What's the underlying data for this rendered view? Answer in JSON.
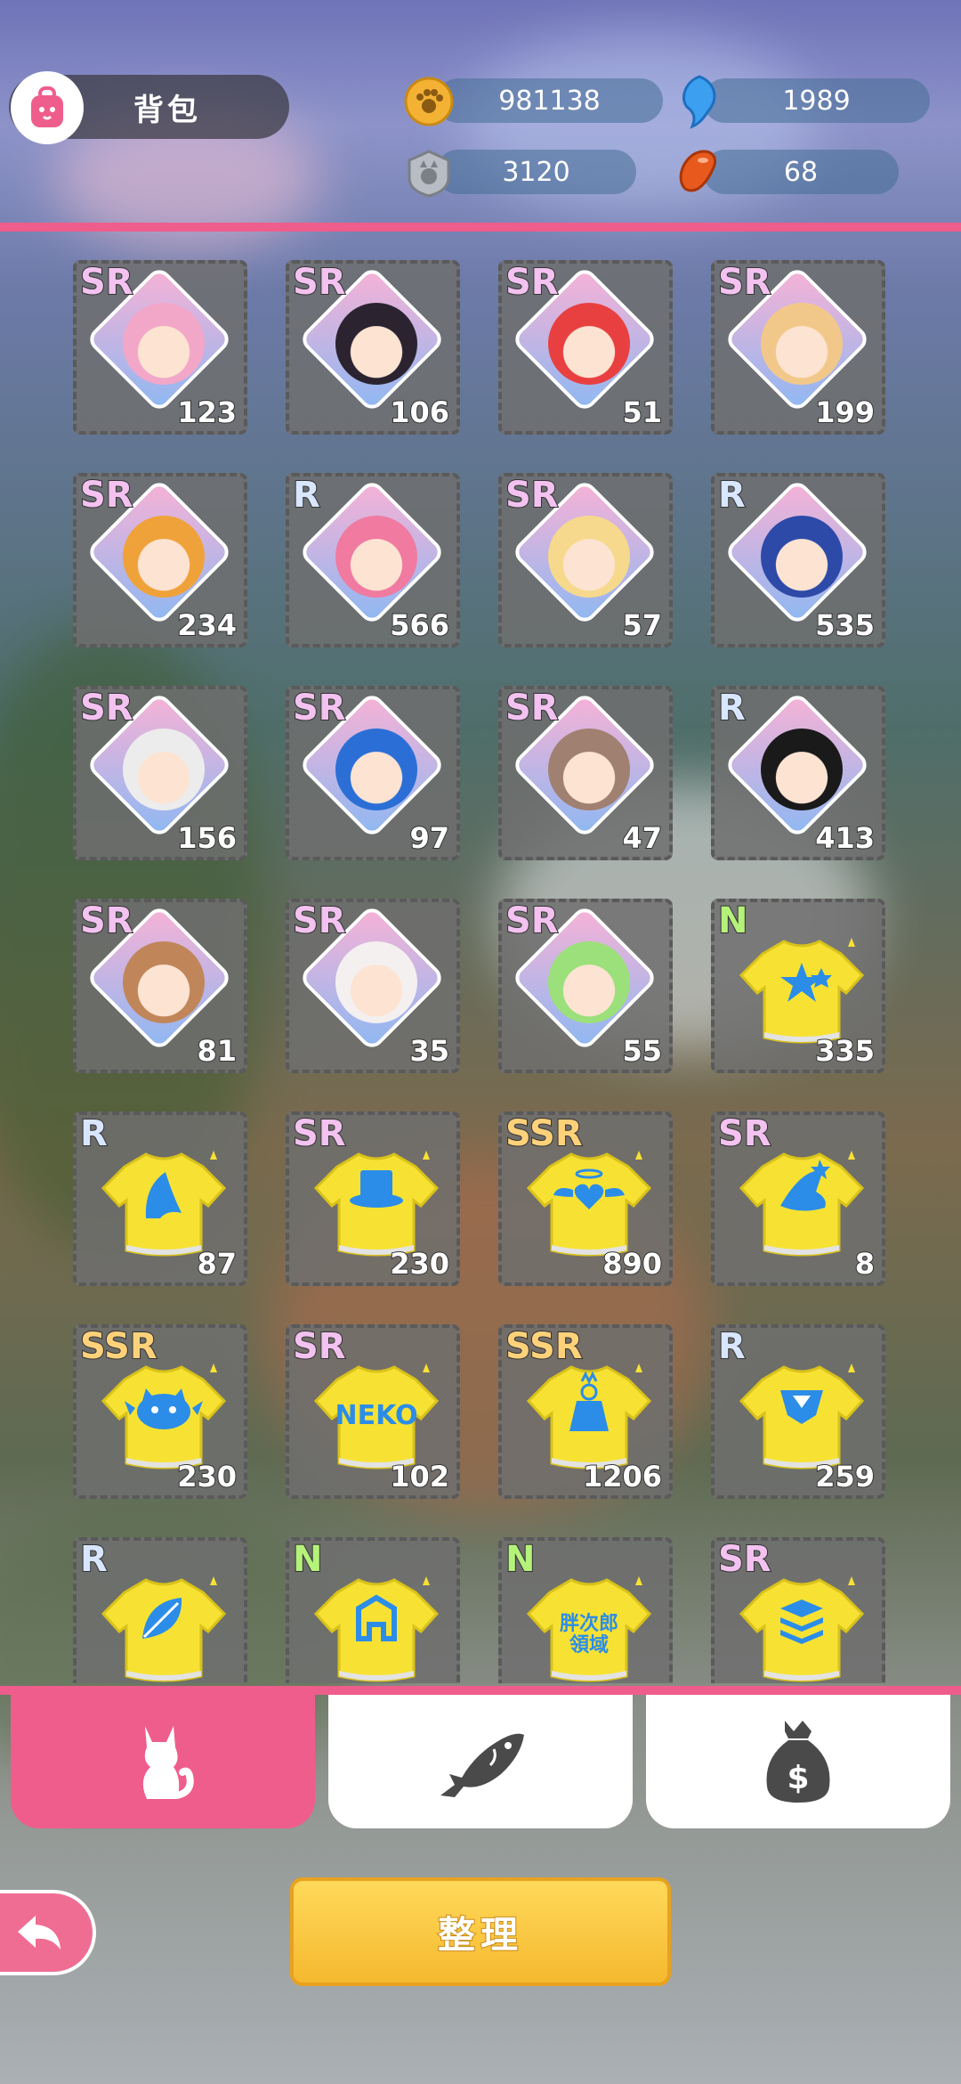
{
  "header": {
    "title": "背包",
    "currencies": [
      {
        "name": "paw-coin",
        "value": "981138",
        "icon": "paw-coin-icon",
        "color": "#f3b233"
      },
      {
        "name": "blue-gem",
        "value": "1989",
        "icon": "blue-fish-gem-icon",
        "color": "#3d9ff0"
      },
      {
        "name": "silver-token",
        "value": "3120",
        "icon": "cat-badge-icon",
        "color": "#b8bcc4"
      },
      {
        "name": "orange-jelly",
        "value": "68",
        "icon": "orange-jelly-icon",
        "color": "#e7591c"
      }
    ]
  },
  "items": [
    {
      "rarity": "SR",
      "count": "123",
      "kind": "character",
      "color": "#f2a7c8"
    },
    {
      "rarity": "SR",
      "count": "106",
      "kind": "character",
      "color": "#2b2430"
    },
    {
      "rarity": "SR",
      "count": "51",
      "kind": "character",
      "color": "#e84040"
    },
    {
      "rarity": "SR",
      "count": "199",
      "kind": "character",
      "color": "#f2c88a"
    },
    {
      "rarity": "SR",
      "count": "234",
      "kind": "character",
      "color": "#f0a23a"
    },
    {
      "rarity": "R",
      "count": "566",
      "kind": "character",
      "color": "#f07aa0"
    },
    {
      "rarity": "SR",
      "count": "57",
      "kind": "character",
      "color": "#f6d98c"
    },
    {
      "rarity": "R",
      "count": "535",
      "kind": "character",
      "color": "#2d4aa8"
    },
    {
      "rarity": "SR",
      "count": "156",
      "kind": "character",
      "color": "#ececec"
    },
    {
      "rarity": "SR",
      "count": "97",
      "kind": "character",
      "color": "#2b6fd6"
    },
    {
      "rarity": "SR",
      "count": "47",
      "kind": "character",
      "color": "#a08070"
    },
    {
      "rarity": "R",
      "count": "413",
      "kind": "character",
      "color": "#1a1a1a"
    },
    {
      "rarity": "SR",
      "count": "81",
      "kind": "character",
      "color": "#c0865a"
    },
    {
      "rarity": "SR",
      "count": "35",
      "kind": "character",
      "color": "#f4f0f0"
    },
    {
      "rarity": "SR",
      "count": "55",
      "kind": "character",
      "color": "#9be07a"
    },
    {
      "rarity": "N",
      "count": "335",
      "kind": "shirt",
      "motif": "stars"
    },
    {
      "rarity": "R",
      "count": "87",
      "kind": "shirt",
      "motif": "fish-tail"
    },
    {
      "rarity": "SR",
      "count": "230",
      "kind": "shirt",
      "motif": "top-hat"
    },
    {
      "rarity": "SSR",
      "count": "890",
      "kind": "shirt",
      "motif": "winged-heart"
    },
    {
      "rarity": "SR",
      "count": "8",
      "kind": "shirt",
      "motif": "wizard-hat"
    },
    {
      "rarity": "SSR",
      "count": "230",
      "kind": "shirt",
      "motif": "bat-cat"
    },
    {
      "rarity": "SR",
      "count": "102",
      "kind": "shirt",
      "motif": "neko-text",
      "text": "NEKO"
    },
    {
      "rarity": "SSR",
      "count": "1206",
      "kind": "shirt",
      "motif": "bride"
    },
    {
      "rarity": "R",
      "count": "259",
      "kind": "shirt",
      "motif": "sailor-collar"
    },
    {
      "rarity": "R",
      "count": "",
      "kind": "shirt",
      "motif": "leaf"
    },
    {
      "rarity": "N",
      "count": "",
      "kind": "shirt",
      "motif": "letter-a"
    },
    {
      "rarity": "N",
      "count": "",
      "kind": "shirt",
      "motif": "kanji-text",
      "text": "胖次郎\n領域"
    },
    {
      "rarity": "SR",
      "count": "",
      "kind": "shirt",
      "motif": "stack"
    }
  ],
  "tabs": [
    {
      "icon": "cat-icon",
      "active": true
    },
    {
      "icon": "fish-icon",
      "active": false
    },
    {
      "icon": "money-bag-icon",
      "active": false
    }
  ],
  "buttons": {
    "sort_label": "整理",
    "back_icon": "back-arrow-icon"
  },
  "colors": {
    "accent": "#ef5d8c",
    "button": "#f5b92f",
    "shirt": "#f7e234",
    "motif": "#2b8de8"
  }
}
